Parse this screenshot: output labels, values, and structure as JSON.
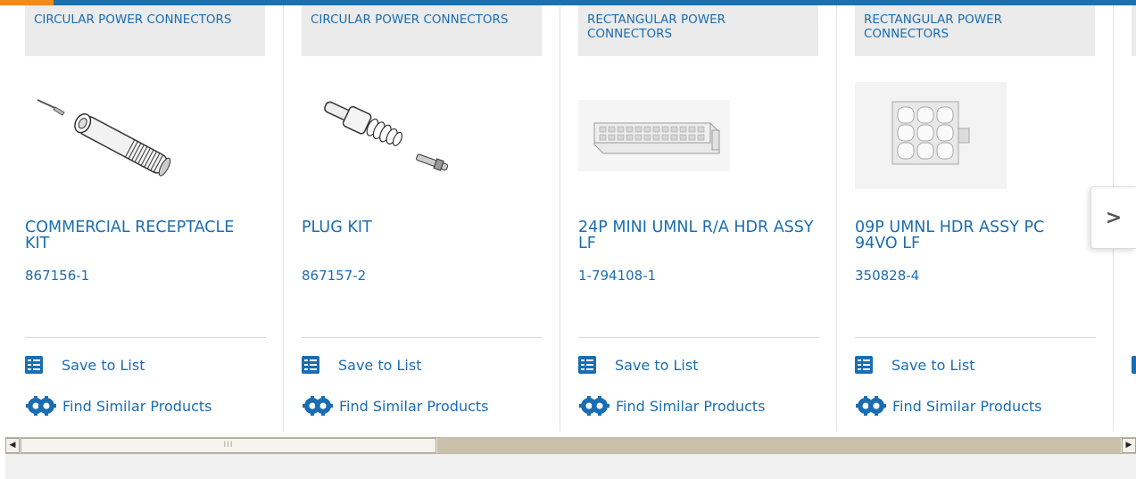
{
  "colors": {
    "link": "#1a6db1",
    "brand_bar": "#1f6fa8",
    "brand_accent": "#f08a1c",
    "category_bg": "#ebebeb"
  },
  "products": [
    {
      "category": "CIRCULAR POWER CONNECTORS",
      "title": "COMMERCIAL RECEPTACLE KIT",
      "part_number": "867156-1",
      "image_icon": "receptacle-kit-image"
    },
    {
      "category": "CIRCULAR POWER CONNECTORS",
      "title": "PLUG KIT",
      "part_number": "867157-2",
      "image_icon": "plug-kit-image"
    },
    {
      "category": "RECTANGULAR POWER CONNECTORS",
      "title": "24P MINI UMNL R/A HDR ASSY LF",
      "part_number": "1-794108-1",
      "image_icon": "header-24p-image"
    },
    {
      "category": "RECTANGULAR POWER CONNECTORS",
      "title": "09P UMNL HDR ASSY PC 94VO LF",
      "part_number": "350828-4",
      "image_icon": "header-9p-image"
    }
  ],
  "actions": {
    "save_label": "Save to List",
    "similar_label": "Find Similar Products"
  },
  "carousel": {
    "next_icon": "chevron-right-icon",
    "next_glyph": ">"
  },
  "scrollbar": {
    "left_glyph": "◀",
    "right_glyph": "▶",
    "grip": "III"
  }
}
